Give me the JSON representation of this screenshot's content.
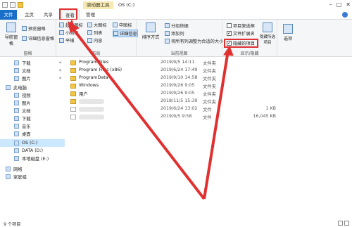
{
  "window": {
    "title": "OS (C:)",
    "context_tool": "驱动器工具",
    "buttons": [
      "–",
      "□",
      "✕"
    ]
  },
  "tabs": [
    {
      "label": "文件"
    },
    {
      "label": "主页"
    },
    {
      "label": "共享"
    },
    {
      "label": "查看"
    },
    {
      "label": "管理"
    }
  ],
  "ribbon": {
    "pane_group": {
      "label": "窗格",
      "nav_pane": "导航窗格",
      "preview_pane": "预览窗格",
      "details_pane": "详细信息窗格"
    },
    "layout_group": {
      "label": "布局",
      "items": [
        "超大图标",
        "大图标",
        "中图标",
        "小图标",
        "列表",
        "详细信息",
        "平铺",
        "内容"
      ]
    },
    "view_group": {
      "label": "当前视图",
      "sort_by": "排序方式",
      "group_by": "分组依据",
      "add_columns": "添加列",
      "fit_columns": "将所有列调整为合适的大小"
    },
    "show_hide_group": {
      "label": "显示/隐藏",
      "item_checkboxes": "项目复选框",
      "file_extensions": "文件扩展名",
      "hidden_items": "隐藏的项目",
      "hide_selected": "隐藏所选项目",
      "item_checkboxes_checked": false,
      "file_extensions_checked": true,
      "hidden_items_checked": true
    },
    "options": "选项"
  },
  "sidebar": {
    "items": [
      {
        "label": "下载",
        "pinned": true
      },
      {
        "label": "文档",
        "pinned": true
      },
      {
        "label": "图片",
        "pinned": true
      },
      {
        "label": "此电脑",
        "pinned": false
      },
      {
        "label": "视频",
        "pinned": false
      },
      {
        "label": "图片",
        "pinned": false
      },
      {
        "label": "文档",
        "pinned": false
      },
      {
        "label": "下载",
        "pinned": false
      },
      {
        "label": "音乐",
        "pinned": false
      },
      {
        "label": "桌面",
        "pinned": false
      },
      {
        "label": "OS (C:)",
        "pinned": false
      },
      {
        "label": "DATA (D:)",
        "pinned": false
      },
      {
        "label": "本地磁盘 (E:)",
        "pinned": false
      },
      {
        "label": "网络",
        "pinned": false
      },
      {
        "label": "家庭组",
        "pinned": false
      }
    ]
  },
  "files": [
    {
      "name": "Program Files",
      "date": "2019/9/5 14:11",
      "type": "文件夹",
      "size": "",
      "kind": "folder"
    },
    {
      "name": "Program Files (x86)",
      "date": "2019/6/24 17:49",
      "type": "文件夹",
      "size": "",
      "kind": "folder"
    },
    {
      "name": "ProgramData",
      "date": "2019/9/10 14:58",
      "type": "文件夹",
      "size": "",
      "kind": "folder"
    },
    {
      "name": "Windows",
      "date": "2019/9/26 9:05",
      "type": "文件夹",
      "size": "",
      "kind": "folder"
    },
    {
      "name": "用户",
      "date": "2019/9/26 9:05",
      "type": "文件夹",
      "size": "",
      "kind": "folder"
    },
    {
      "name": "",
      "date": "2018/11/5 15:39",
      "type": "文件夹",
      "size": "",
      "kind": "blurred"
    },
    {
      "name": "",
      "date": "2019/6/24 13:02",
      "type": "文件",
      "size": "1 KB",
      "kind": "blurred-file"
    },
    {
      "name": "",
      "date": "2019/9/5 9:58",
      "type": "文件",
      "size": "16,045 KB",
      "kind": "blurred-file"
    }
  ],
  "status": {
    "count": "9 个项目"
  },
  "colors": {
    "file_tab": "#1a6fc9",
    "highlight_red": "#e03030",
    "selected_nav": "#cce8ff"
  }
}
